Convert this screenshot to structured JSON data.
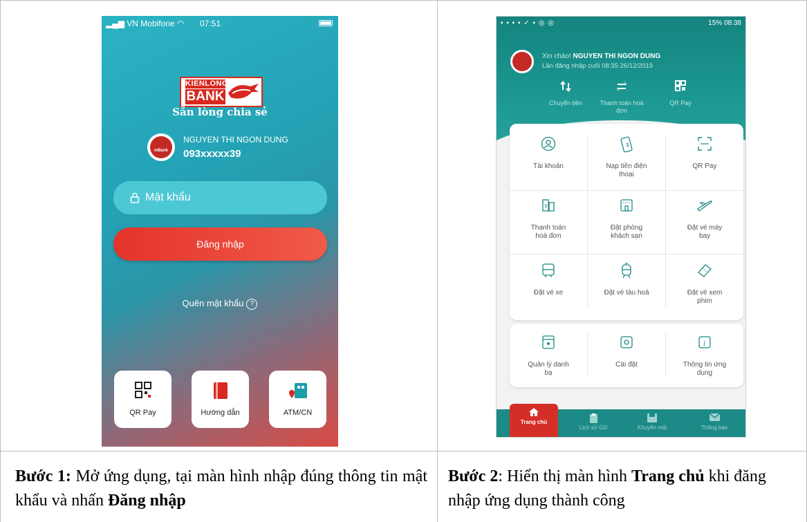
{
  "login_screen": {
    "status": {
      "carrier": "VN Mobifone",
      "time": "07:51"
    },
    "brand": {
      "line1": "KIENLONG",
      "line2": "BANK",
      "slogan": "Sẵn lòng chia sẻ"
    },
    "user": {
      "name": "NGUYEN THI NGON DUNG",
      "phone": "093xxxxx39",
      "avatar_badge": "mBank"
    },
    "password_placeholder": "Mật khẩu",
    "login_button": "Đăng nhập",
    "forgot_password": "Quên mật khẩu",
    "tiles": [
      {
        "label": "QR Pay",
        "icon": "qr-code-icon"
      },
      {
        "label": "Hướng dẫn",
        "icon": "guide-book-icon"
      },
      {
        "label": "ATM/CN",
        "icon": "atm-location-icon"
      }
    ],
    "colors": {
      "teal": "#2bb3c3",
      "red": "#e4332b"
    }
  },
  "home_screen": {
    "status": {
      "left_icons": "▪ ▪ ▪ ▪ ✓ ▪ ◎ ◎",
      "right": "15% 08:38"
    },
    "greeting": {
      "prefix": "Xin chào!",
      "name": "NGUYEN THI NGON DUNG",
      "last_login": "Lần đăng nhập cuối 08:35 26/12/2019"
    },
    "quick_actions": [
      {
        "label": "Chuyển tiền",
        "icon": "transfer-icon"
      },
      {
        "label": "Thanh toán hoá đơn",
        "icon": "bill-payment-icon"
      },
      {
        "label": "QR Pay",
        "icon": "qr-code-icon"
      }
    ],
    "services": [
      {
        "label": "Tài khoản",
        "icon": "account-icon"
      },
      {
        "label": "Nạp tiền điện thoại",
        "icon": "phone-topup-icon"
      },
      {
        "label": "QR Pay",
        "icon": "qr-scan-icon"
      },
      {
        "label": "Thanh toán hoá đơn",
        "icon": "bill-icon"
      },
      {
        "label": "Đặt phòng khách sạn",
        "icon": "hotel-icon"
      },
      {
        "label": "Đặt vé máy bay",
        "icon": "plane-icon"
      },
      {
        "label": "Đặt vé xe",
        "icon": "bus-icon"
      },
      {
        "label": "Đặt vé tàu hoả",
        "icon": "train-icon"
      },
      {
        "label": "Đặt vé xem phim",
        "icon": "movie-ticket-icon"
      }
    ],
    "utilities": [
      {
        "label": "Quản lý danh bạ",
        "icon": "contacts-icon"
      },
      {
        "label": "Cài đặt",
        "icon": "settings-icon"
      },
      {
        "label": "Thông tin ứng dụng",
        "icon": "info-icon"
      }
    ],
    "nav": [
      {
        "label": "Trang chủ",
        "icon": "home-icon"
      },
      {
        "label": "Lịch sử GD",
        "icon": "history-icon"
      },
      {
        "label": "Khuyến mãi",
        "icon": "promotion-icon"
      },
      {
        "label": "Thông báo",
        "icon": "mail-icon"
      }
    ],
    "colors": {
      "teal": "#14847f",
      "nav_active": "#d42f27"
    }
  },
  "captions": {
    "step1": {
      "label": "Bước 1:",
      "text1": " Mở ứng dụng, tại màn hình nhập đúng thông tin mật khẩu và nhấn ",
      "action": "Đăng nhập"
    },
    "step2": {
      "label": "Bước 2",
      "text1": ": Hiển thị màn hình ",
      "screen": "Trang chủ",
      "text2": " khi đăng nhập ứng dụng thành công"
    }
  }
}
